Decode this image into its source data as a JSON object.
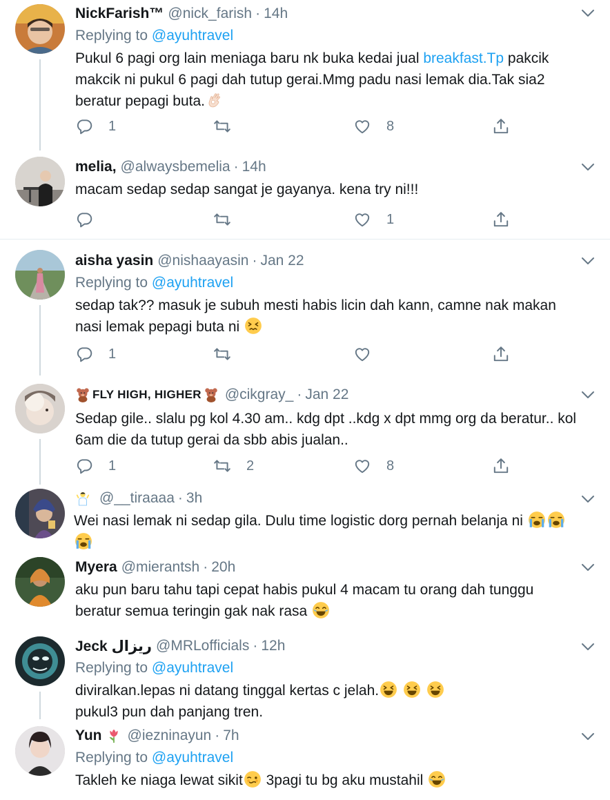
{
  "tweets": [
    {
      "name": "NickFarish™",
      "handle": "@nick_farish",
      "time": "14h",
      "replying_prefix": "Replying to",
      "replying_to": "@ayuhtravel",
      "text_a": "Pukul 6 pagi org lain meniaga baru nk buka kedai jual ",
      "link": "breakfast.Tp",
      "text_b": " pakcik makcik ni pukul 6 pagi dah tutup gerai.Mmg padu nasi lemak dia.Tak sia2 beratur pepagi buta.",
      "replies": "1",
      "retweets": "",
      "likes": "8"
    },
    {
      "name": "melia,",
      "handle": "@alwaysbemelia",
      "time": "14h",
      "text": "macam sedap sedap sangat je gayanya. kena try ni!!!",
      "replies": "",
      "retweets": "",
      "likes": "1"
    },
    {
      "name": "aisha yasin",
      "handle": "@nishaayasin",
      "time": "Jan 22",
      "replying_prefix": "Replying to",
      "replying_to": "@ayuhtravel",
      "text": "sedap tak?? masuk je subuh mesti habis licin dah kann, camne nak makan nasi lemak pepagi buta ni",
      "replies": "1",
      "retweets": "",
      "likes": ""
    },
    {
      "name": "FLY HIGH, HIGHER",
      "handle": "@cikgray_",
      "time": "Jan 22",
      "text": "Sedap gile.. slalu pg kol 4.30 am.. kdg dpt ..kdg x dpt mmg org da beratur.. kol 6am die da tutup gerai da sbb abis jualan..",
      "replies": "1",
      "retweets": "2",
      "likes": "8"
    },
    {
      "name": "",
      "handle": "@__tiraaaa",
      "time": "3h",
      "text": "Wei nasi lemak ni sedap gila. Dulu time logistic dorg pernah belanja ni"
    },
    {
      "name": "Myera",
      "handle": "@mierantsh",
      "time": "20h",
      "text": "aku pun baru tahu tapi cepat habis pukul 4 macam tu orang dah tunggu beratur semua teringin gak nak rasa"
    },
    {
      "name": "Jeck ريزال",
      "handle": "@MRLofficials",
      "time": "12h",
      "replying_prefix": "Replying to",
      "replying_to": "@ayuhtravel",
      "text_a": "diviralkan.lepas ni datang tinggal kertas c jelah.",
      "text_b": "pukul3 pun dah panjang tren."
    },
    {
      "name": "Yun",
      "handle": "@iezninayun",
      "time": "7h",
      "replying_prefix": "Replying to",
      "replying_to": "@ayuhtravel",
      "text_a": "Takleh ke niaga lewat sikit",
      "text_b": " 3pagi tu bg aku mustahil "
    }
  ],
  "sep": "·",
  "colors": {
    "accent": "#1da1f2",
    "muted": "#657786",
    "text": "#14171a",
    "divider": "#e6ecf0"
  },
  "icons": [
    "reply-icon",
    "retweet-icon",
    "like-icon",
    "share-icon",
    "caret-down-icon",
    "ok-hand-emoji",
    "persevering-face-emoji",
    "teddy-bear-emoji",
    "person-gesturing-emoji",
    "crying-face-emoji",
    "tears-of-joy-emoji",
    "laughing-face-emoji",
    "tulip-emoji",
    "woozy-face-emoji"
  ]
}
